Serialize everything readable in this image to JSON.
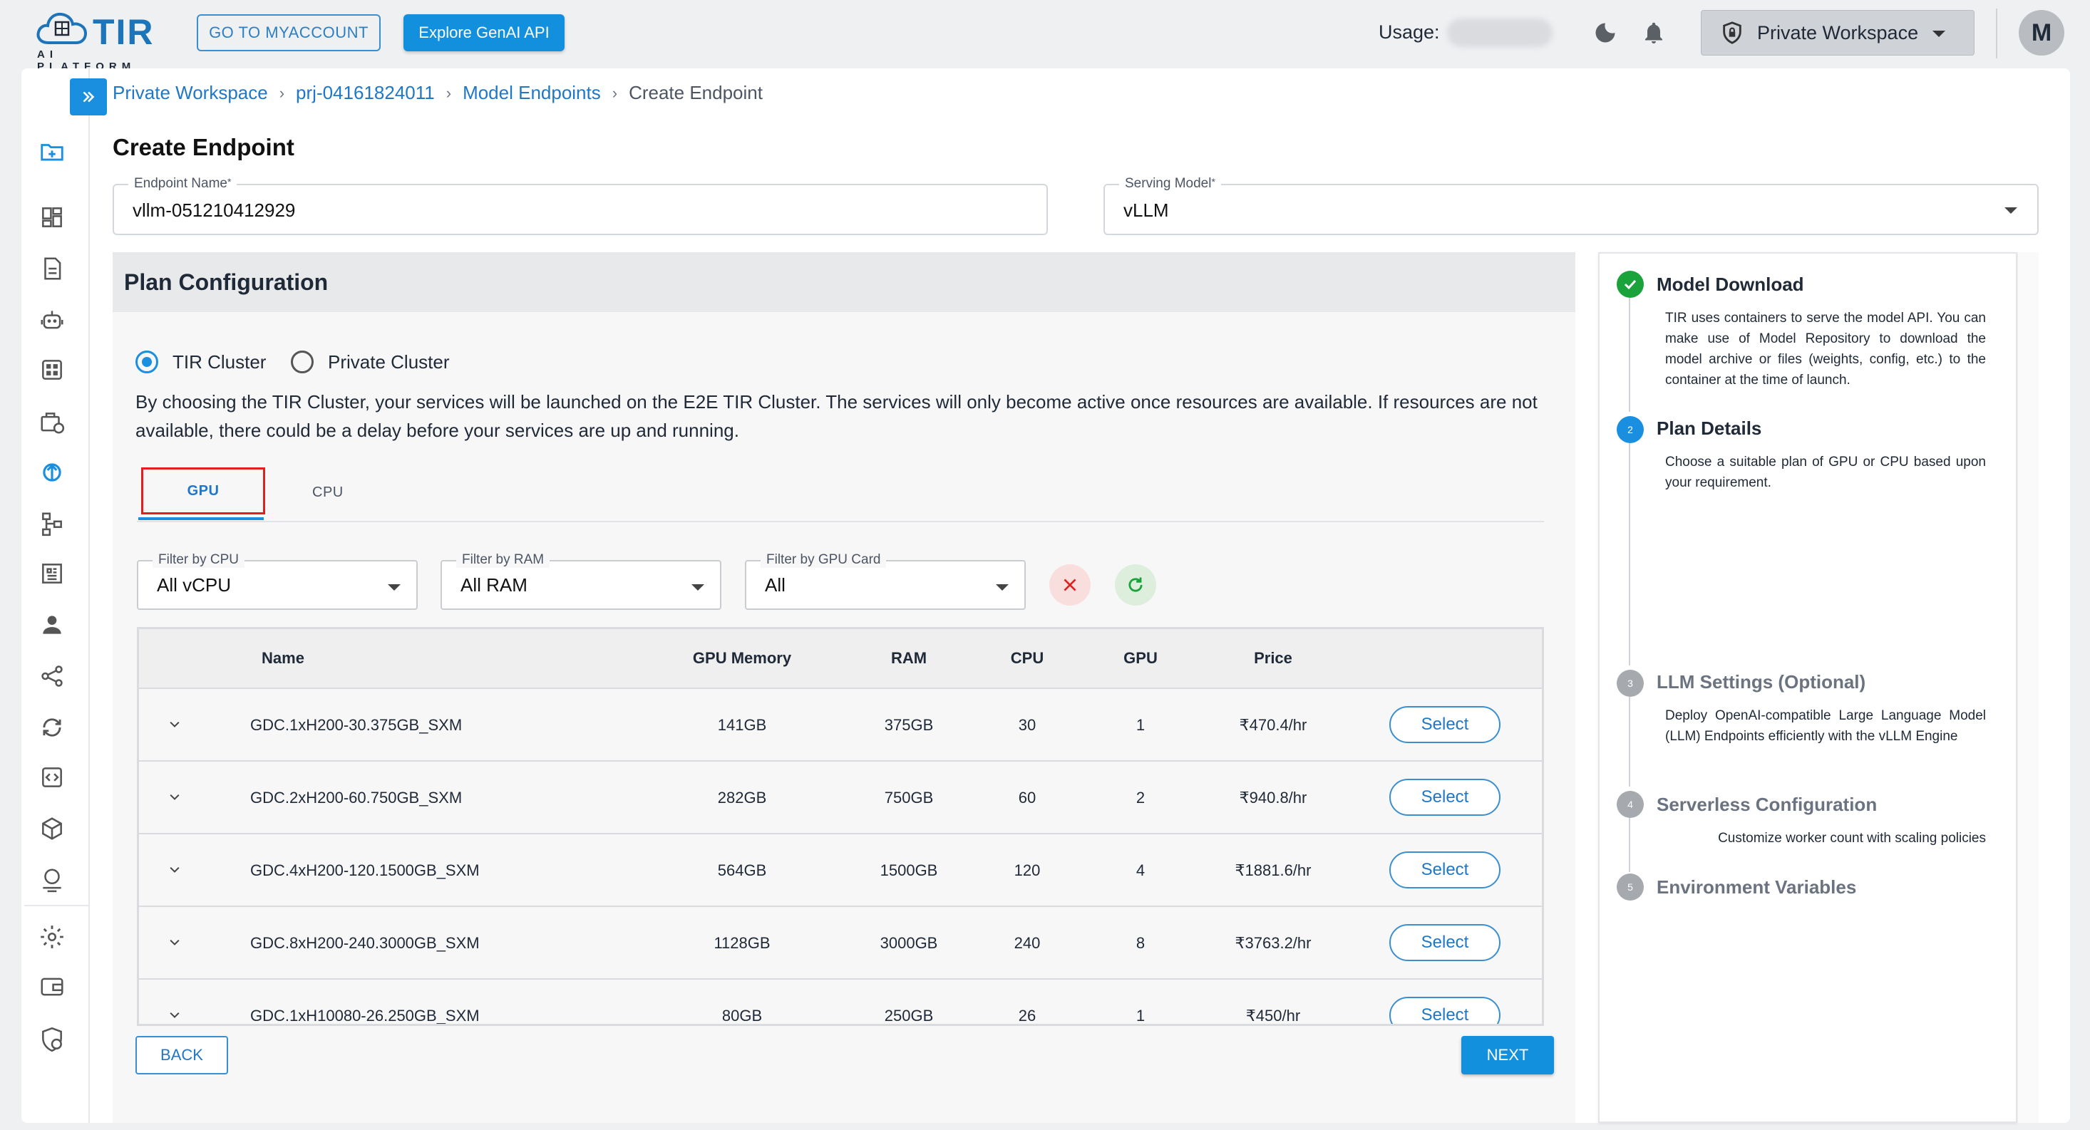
{
  "brand": {
    "name": "TIR",
    "subtitle": "AI PLATFORM"
  },
  "header": {
    "myaccount_label": "GO TO MYACCOUNT",
    "genai_label": "Explore GenAI API",
    "usage_label": "Usage:",
    "workspace_label": "Private Workspace",
    "avatar_initial": "M"
  },
  "breadcrumb": {
    "items": [
      "Private Workspace",
      "prj-04161824011",
      "Model Endpoints"
    ],
    "current": "Create Endpoint",
    "separator": "›"
  },
  "page": {
    "title": "Create Endpoint"
  },
  "form": {
    "endpoint_name": {
      "label": "Endpoint Name",
      "required": "*",
      "value": "vllm-051210412929"
    },
    "serving_model": {
      "label": "Serving Model",
      "required": "*",
      "value": "vLLM"
    }
  },
  "plan": {
    "title": "Plan Configuration",
    "radios": [
      {
        "label": "TIR Cluster",
        "selected": true
      },
      {
        "label": "Private Cluster",
        "selected": false
      }
    ],
    "description": "By choosing the TIR Cluster, your services will be launched on the E2E TIR Cluster. The services will only become active once resources are available. If resources are not available, there could be a delay before your services are up and running.",
    "tabs": [
      {
        "label": "GPU",
        "active": true
      },
      {
        "label": "CPU",
        "active": false
      }
    ],
    "filters": [
      {
        "label": "Filter by CPU",
        "value": "All vCPU"
      },
      {
        "label": "Filter by RAM",
        "value": "All RAM"
      },
      {
        "label": "Filter by GPU Card",
        "value": "All"
      }
    ],
    "table": {
      "columns": [
        "Name",
        "GPU Memory",
        "RAM",
        "CPU",
        "GPU",
        "Price"
      ],
      "select_label": "Select",
      "rows": [
        {
          "name": "GDC.1xH200-30.375GB_SXM",
          "gpu_memory": "141GB",
          "ram": "375GB",
          "cpu": "30",
          "gpu": "1",
          "price": "₹470.4/hr"
        },
        {
          "name": "GDC.2xH200-60.750GB_SXM",
          "gpu_memory": "282GB",
          "ram": "750GB",
          "cpu": "60",
          "gpu": "2",
          "price": "₹940.8/hr"
        },
        {
          "name": "GDC.4xH200-120.1500GB_SXM",
          "gpu_memory": "564GB",
          "ram": "1500GB",
          "cpu": "120",
          "gpu": "4",
          "price": "₹1881.6/hr"
        },
        {
          "name": "GDC.8xH200-240.3000GB_SXM",
          "gpu_memory": "1128GB",
          "ram": "3000GB",
          "cpu": "240",
          "gpu": "8",
          "price": "₹3763.2/hr"
        },
        {
          "name": "GDC.1xH10080-26.250GB_SXM",
          "gpu_memory": "80GB",
          "ram": "250GB",
          "cpu": "26",
          "gpu": "1",
          "price": "₹450/hr"
        }
      ]
    },
    "back_label": "BACK",
    "next_label": "NEXT"
  },
  "stepper": {
    "steps": [
      {
        "number": "✓",
        "title": "Model Download",
        "status": "done",
        "description": "TIR uses containers to serve the model API. You can make use of Model Repository to download the model archive or files (weights, config, etc.) to the container at the time of launch."
      },
      {
        "number": "2",
        "title": "Plan Details",
        "status": "active",
        "description": "Choose a suitable plan of GPU or CPU based upon your requirement."
      },
      {
        "number": "3",
        "title": "LLM Settings (Optional)",
        "status": "pending",
        "description": "Deploy OpenAI-compatible Large Language Model (LLM) Endpoints efficiently with the vLLM Engine"
      },
      {
        "number": "4",
        "title": "Serverless Configuration",
        "status": "pending",
        "description": "Customize worker count with scaling policies"
      },
      {
        "number": "5",
        "title": "Environment Variables",
        "status": "pending",
        "description": ""
      }
    ]
  },
  "colors": {
    "primary": "#1290dd",
    "link": "#1f77c8",
    "success": "#1aa33a",
    "danger": "#e02020"
  },
  "sidebar": {
    "icons": [
      "folder-add-icon",
      "dashboard-icon",
      "document-icon",
      "robot-icon",
      "grid-icon",
      "container-icon",
      "model-endpoint-icon",
      "pipeline-icon",
      "registry-icon",
      "user-icon",
      "share-icon",
      "sync-icon",
      "code-icon",
      "package-icon",
      "monitor-icon",
      "settings-icon",
      "wallet-icon",
      "security-icon"
    ]
  }
}
